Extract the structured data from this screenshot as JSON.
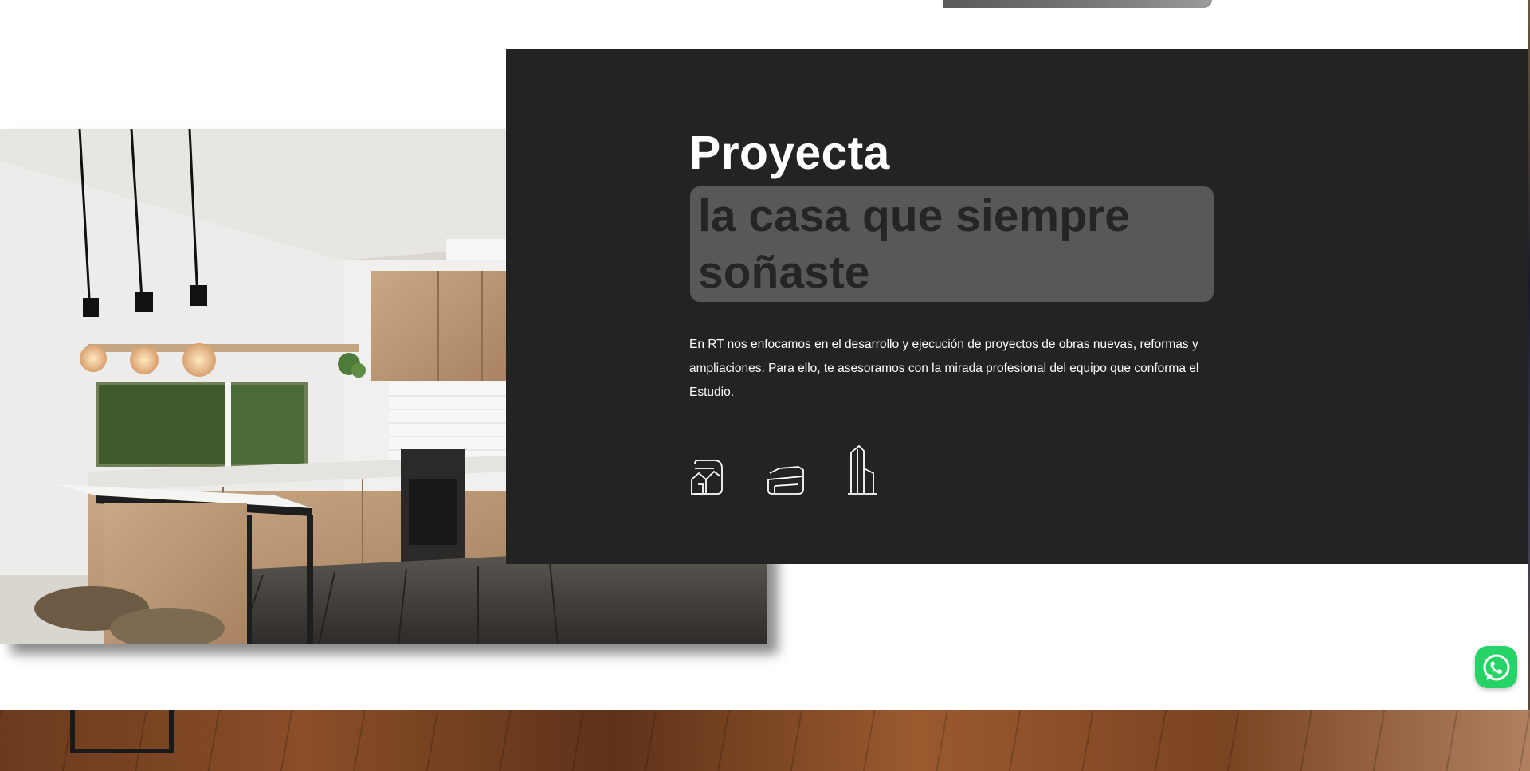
{
  "hero": {
    "headline": "Proyecta",
    "subheadline": "la casa que siempre soñaste",
    "description": "En RT nos enfocamos en el desarrollo y ejecución de proyectos de obras nuevas, reformas y ampliaciones. Para ello, te asesoramos con la mirada profesional del equipo que conforma el Estudio."
  },
  "features": [
    {
      "icon": "house-outline-icon"
    },
    {
      "icon": "modern-building-icon"
    },
    {
      "icon": "tower-building-icon"
    }
  ],
  "colors": {
    "panel": "#232323",
    "highlight": "#585858",
    "whatsapp": "#25d366"
  },
  "icons": {
    "contact": "whatsapp-icon"
  }
}
